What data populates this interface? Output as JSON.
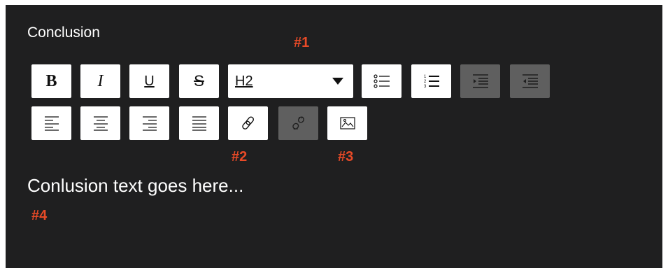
{
  "section_title": "Conclusion",
  "toolbar": {
    "bold": {
      "glyph": "B",
      "icon": "bold-icon"
    },
    "italic": {
      "glyph": "I",
      "icon": "italic-icon"
    },
    "underline": {
      "glyph": "U",
      "icon": "underline-icon"
    },
    "strikethrough": {
      "glyph": "S",
      "icon": "strikethrough-icon"
    },
    "heading_select": {
      "value": "H2"
    },
    "icons": [
      "bulleted-list-icon",
      "numbered-list-icon",
      "indent-icon",
      "outdent-icon",
      "align-left-icon",
      "align-center-icon",
      "align-right-icon",
      "align-justify-icon",
      "link-icon",
      "unlink-icon",
      "image-icon"
    ]
  },
  "editor_content": "Conlusion text goes here...",
  "annotations": {
    "a1": "#1",
    "a2": "#2",
    "a3": "#3",
    "a4": "#4"
  },
  "colors": {
    "panel_bg": "#1f1f20",
    "button_bg": "#ffffff",
    "disabled_bg": "#5f5f5f",
    "annotation": "#e84a27"
  }
}
